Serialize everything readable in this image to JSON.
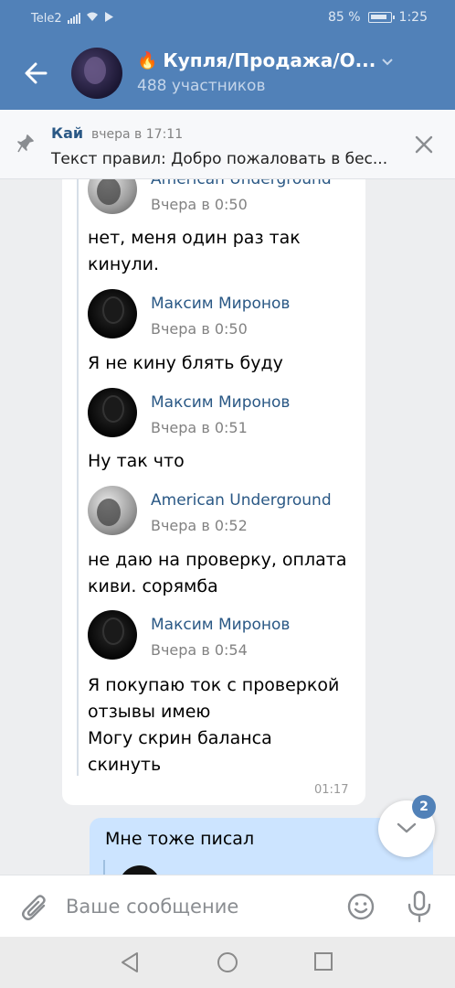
{
  "status_bar": {
    "carrier": "Tele2",
    "battery": "85 %",
    "time": "1:25"
  },
  "header": {
    "title": "Купля/Продажа/О...",
    "members": "488 участников"
  },
  "pinned": {
    "author": "Кай",
    "time": "вчера в 17:11",
    "text": "Текст правил: Добро пожаловать в бес..."
  },
  "messages": [
    {
      "author": "American Underground",
      "time": "Вчера в 0:50",
      "avatar": "light",
      "text": "нет, меня один раз так\nкинули."
    },
    {
      "author": "Максим Миронов",
      "time": "Вчера в 0:50",
      "avatar": "dark",
      "text": "Я не кину блять буду"
    },
    {
      "author": "Максим Миронов",
      "time": "Вчера в 0:51",
      "avatar": "dark",
      "text": "Ну так что"
    },
    {
      "author": "American Underground",
      "time": "Вчера в 0:52",
      "avatar": "light",
      "text": "не даю на проверку, оплата\nкиви. сорямба"
    },
    {
      "author": "Максим Миронов",
      "time": "Вчера в 0:54",
      "avatar": "dark",
      "text": "Я покупаю ток с проверкой\nотзывы имею\nМогу скрин баланса\nскинуть"
    }
  ],
  "bubble_time": "01:17",
  "outgoing": {
    "text": "Мне тоже писал"
  },
  "unread_badge": "2",
  "composer": {
    "placeholder": "Ваше сообщение"
  }
}
